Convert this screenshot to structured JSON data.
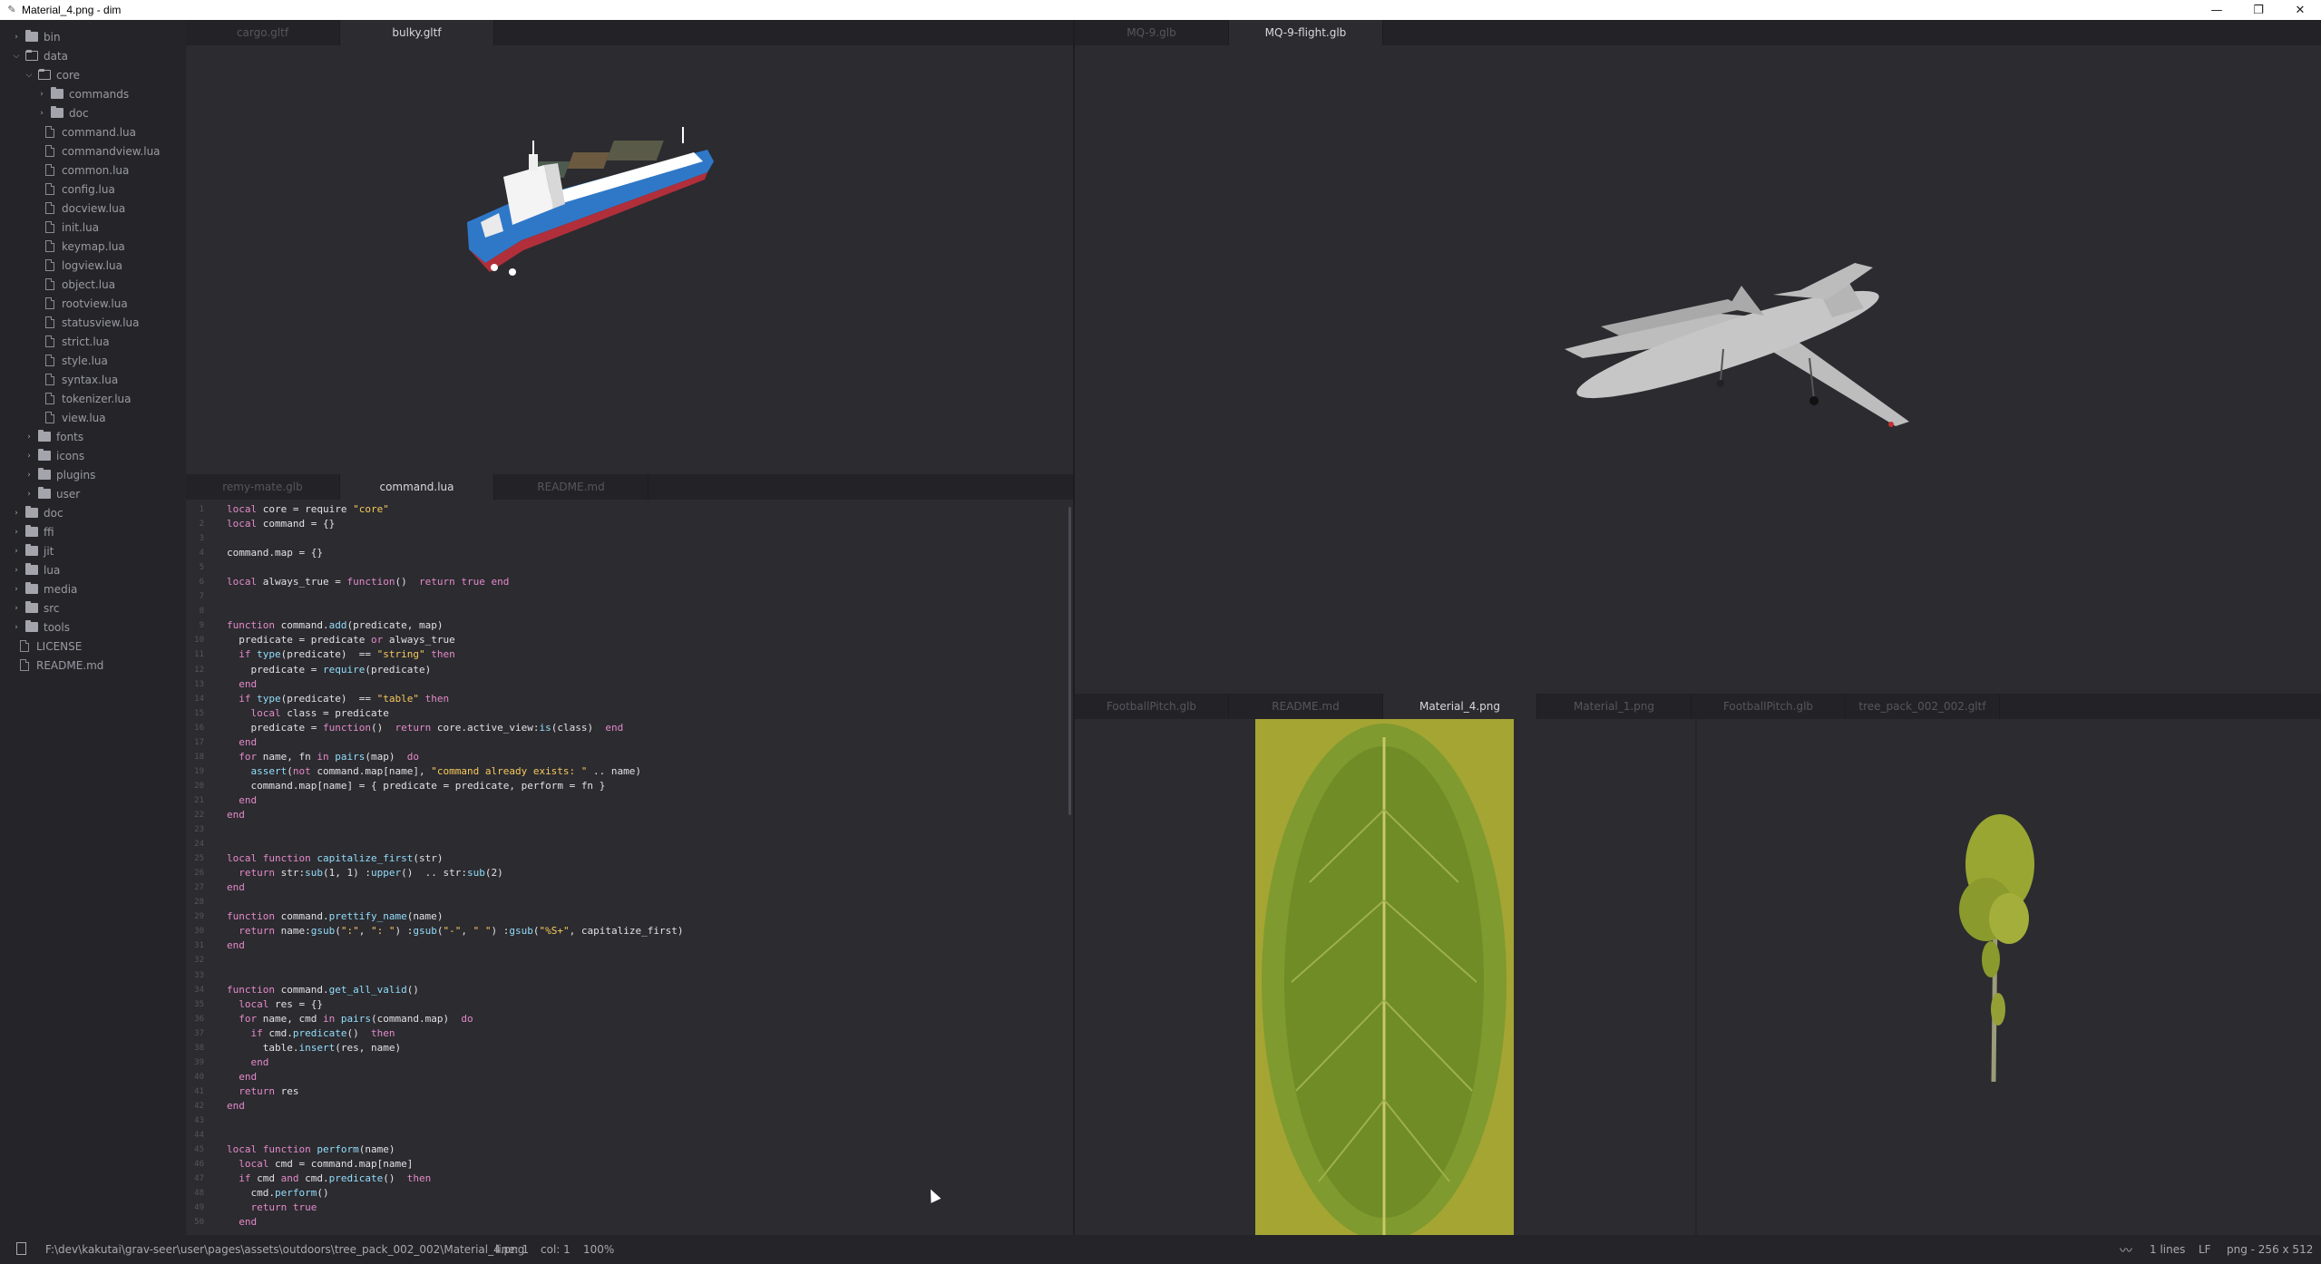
{
  "window": {
    "title": "Material_4.png - dim"
  },
  "sidebar": {
    "items": [
      {
        "label": "bin",
        "kind": "folder",
        "depth": 0,
        "open": false
      },
      {
        "label": "data",
        "kind": "folder",
        "depth": 0,
        "open": true
      },
      {
        "label": "core",
        "kind": "folder",
        "depth": 1,
        "open": true
      },
      {
        "label": "commands",
        "kind": "folder",
        "depth": 2,
        "open": false
      },
      {
        "label": "doc",
        "kind": "folder",
        "depth": 2,
        "open": false
      },
      {
        "label": "command.lua",
        "kind": "file",
        "depth": 2
      },
      {
        "label": "commandview.lua",
        "kind": "file",
        "depth": 2
      },
      {
        "label": "common.lua",
        "kind": "file",
        "depth": 2
      },
      {
        "label": "config.lua",
        "kind": "file",
        "depth": 2
      },
      {
        "label": "docview.lua",
        "kind": "file",
        "depth": 2
      },
      {
        "label": "init.lua",
        "kind": "file",
        "depth": 2
      },
      {
        "label": "keymap.lua",
        "kind": "file",
        "depth": 2
      },
      {
        "label": "logview.lua",
        "kind": "file",
        "depth": 2
      },
      {
        "label": "object.lua",
        "kind": "file",
        "depth": 2
      },
      {
        "label": "rootview.lua",
        "kind": "file",
        "depth": 2
      },
      {
        "label": "statusview.lua",
        "kind": "file",
        "depth": 2
      },
      {
        "label": "strict.lua",
        "kind": "file",
        "depth": 2
      },
      {
        "label": "style.lua",
        "kind": "file",
        "depth": 2
      },
      {
        "label": "syntax.lua",
        "kind": "file",
        "depth": 2
      },
      {
        "label": "tokenizer.lua",
        "kind": "file",
        "depth": 2
      },
      {
        "label": "view.lua",
        "kind": "file",
        "depth": 2
      },
      {
        "label": "fonts",
        "kind": "folder",
        "depth": 1,
        "open": false
      },
      {
        "label": "icons",
        "kind": "folder",
        "depth": 1,
        "open": false
      },
      {
        "label": "plugins",
        "kind": "folder",
        "depth": 1,
        "open": false
      },
      {
        "label": "user",
        "kind": "folder",
        "depth": 1,
        "open": false
      },
      {
        "label": "doc",
        "kind": "folder",
        "depth": 0,
        "open": false
      },
      {
        "label": "ffi",
        "kind": "folder",
        "depth": 0,
        "open": false
      },
      {
        "label": "jit",
        "kind": "folder",
        "depth": 0,
        "open": false
      },
      {
        "label": "lua",
        "kind": "folder",
        "depth": 0,
        "open": false
      },
      {
        "label": "media",
        "kind": "folder",
        "depth": 0,
        "open": false
      },
      {
        "label": "src",
        "kind": "folder",
        "depth": 0,
        "open": false
      },
      {
        "label": "tools",
        "kind": "folder",
        "depth": 0,
        "open": false
      },
      {
        "label": "LICENSE",
        "kind": "file",
        "depth": 0
      },
      {
        "label": "README.md",
        "kind": "file",
        "depth": 0
      }
    ]
  },
  "panes": {
    "top_left": {
      "tabs": [
        "cargo.gltf",
        "bulky.gltf"
      ],
      "active": 1
    },
    "top_right": {
      "tabs": [
        "MQ-9.glb",
        "MQ-9-flight.glb"
      ],
      "active": 1
    },
    "code": {
      "tabs": [
        "remy-mate.glb",
        "command.lua",
        "README.md"
      ],
      "active": 1
    },
    "bottom_right": {
      "tabs": [
        "FootballPitch.glb",
        "README.md",
        "Material_4.png",
        "Material_1.png",
        "FootballPitch.glb",
        "tree_pack_002_002.gltf"
      ],
      "active": 2
    }
  },
  "code_lines": [
    "local core = require \"core\"",
    "local command = {}",
    "",
    "command.map = {}",
    "",
    "local always_true = function()  return true end",
    "",
    "",
    "function command.add(predicate, map)",
    "  predicate = predicate or always_true",
    "  if type(predicate)  == \"string\" then",
    "    predicate = require(predicate)",
    "  end",
    "  if type(predicate)  == \"table\" then",
    "    local class = predicate",
    "    predicate = function()  return core.active_view:is(class)  end",
    "  end",
    "  for name, fn in pairs(map)  do",
    "    assert(not command.map[name], \"command already exists: \" .. name)",
    "    command.map[name] = { predicate = predicate, perform = fn }",
    "  end",
    "end",
    "",
    "",
    "local function capitalize_first(str)",
    "  return str:sub(1, 1) :upper()  .. str:sub(2)",
    "end",
    "",
    "function command.prettify_name(name)",
    "  return name:gsub(\":\", \": \") :gsub(\"-\", \" \") :gsub(\"%S+\", capitalize_first)",
    "end",
    "",
    "",
    "function command.get_all_valid()",
    "  local res = {}",
    "  for name, cmd in pairs(command.map)  do",
    "    if cmd.predicate()  then",
    "      table.insert(res, name)",
    "    end",
    "  end",
    "  return res",
    "end",
    "",
    "",
    "local function perform(name)",
    "  local cmd = command.map[name]",
    "  if cmd and cmd.predicate()  then",
    "    cmd.perform()",
    "    return true",
    "  end"
  ],
  "status": {
    "path": "F:\\dev\\kakutai\\grav-seer\\user\\pages\\assets\\outdoors\\tree_pack_002_002\\Material_4.png",
    "line": "line: 1",
    "col": "col: 1",
    "zoom": "100%",
    "lines": "1 lines",
    "eol": "LF",
    "filetype": "png - 256 x 512"
  },
  "colors": {
    "background": "#2b2b30",
    "sidebar": "#252529",
    "keyword": "#e58ac9",
    "function": "#93ddfa",
    "string": "#f7c95c",
    "leaf_bg": "#a5a534"
  }
}
